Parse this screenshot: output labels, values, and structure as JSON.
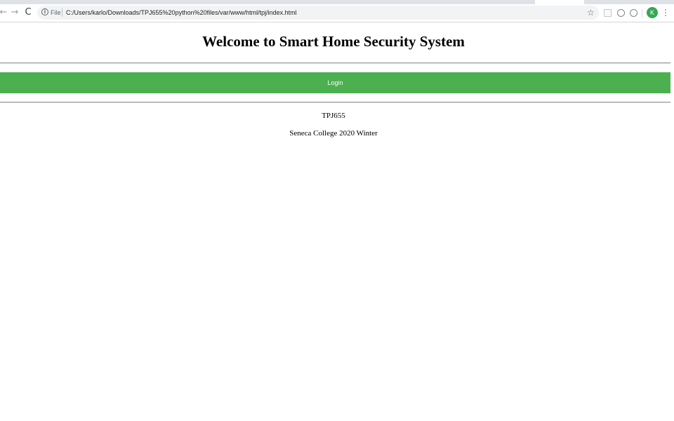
{
  "browser": {
    "back_glyph": "←",
    "forward_glyph": "→",
    "reload_glyph": "C",
    "info_glyph": "i",
    "scheme": "File",
    "url": "C:/Users/karlo/Downloads/TPJ655%20python%20files/var/www/html/tpj/index.html",
    "star_glyph": "☆",
    "avatar_letter": "K",
    "menu_glyph": "⋮",
    "icons": [
      "back-arrow-icon",
      "forward-arrow-icon",
      "reload-icon",
      "info-icon",
      "star-icon",
      "extension-icon",
      "menu-icon"
    ]
  },
  "page": {
    "title": "Welcome to Smart Home Security System",
    "login_label": "Login",
    "course": "TPJ655",
    "school": "Seneca College 2020 Winter"
  },
  "colors": {
    "login_button": "#4caf50",
    "avatar": "#34a853"
  }
}
